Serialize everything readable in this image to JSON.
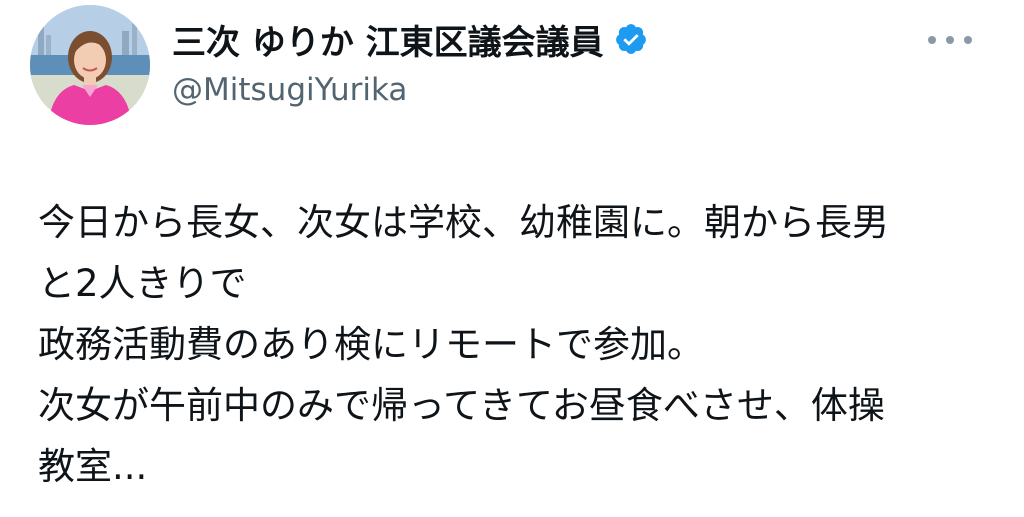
{
  "author": {
    "display_name": "三次 ゆりか 江東区議会議員",
    "handle": "@MitsugiYurika",
    "verified": true,
    "avatar_icon": "profile-photo-icon",
    "verified_icon": "verified-badge-icon"
  },
  "menu": {
    "icon": "more-options-icon"
  },
  "tweet": {
    "lines": [
      "今日から長女、次女は学校、幼稚園に。朝から長男",
      "と2人きりで",
      "政務活動費のあり検にリモートで参加。",
      "次女が午前中のみで帰ってきてお昼食べさせ、体操",
      "教室..."
    ]
  },
  "colors": {
    "text": "#0f1419",
    "secondary": "#536471",
    "verified_blue": "#1d9bf0",
    "avatar_shirt": "#ec3fa3"
  }
}
